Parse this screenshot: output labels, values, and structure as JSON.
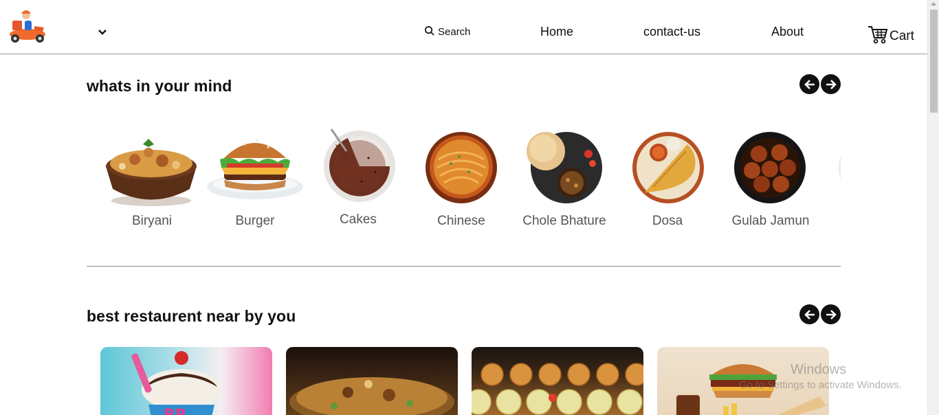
{
  "header": {
    "search_label": "Search",
    "nav": {
      "home": "Home",
      "contact": "contact-us",
      "about": "About",
      "cart": "Cart"
    }
  },
  "sections": {
    "mind": {
      "title": "whats in your mind"
    },
    "restaurants": {
      "title": "best restaurent near by you"
    }
  },
  "foods": [
    {
      "label": "Biryani",
      "icon": "biryani-bowl"
    },
    {
      "label": "Burger",
      "icon": "burger-plate"
    },
    {
      "label": "Cakes",
      "icon": "cake-plate"
    },
    {
      "label": "Chinese",
      "icon": "noodles-plate"
    },
    {
      "label": "Chole Bhature",
      "icon": "chole-bhature-plate"
    },
    {
      "label": "Dosa",
      "icon": "dosa-plate"
    },
    {
      "label": "Gulab Jamun",
      "icon": "gulab-jamun-bowl"
    }
  ],
  "overlay": {
    "watermark_title": "Windows",
    "watermark_text": "Go to Settings to activate Windows."
  },
  "colors": {
    "accent": "#111111",
    "divider": "#8f8f8f",
    "label": "#555555"
  }
}
